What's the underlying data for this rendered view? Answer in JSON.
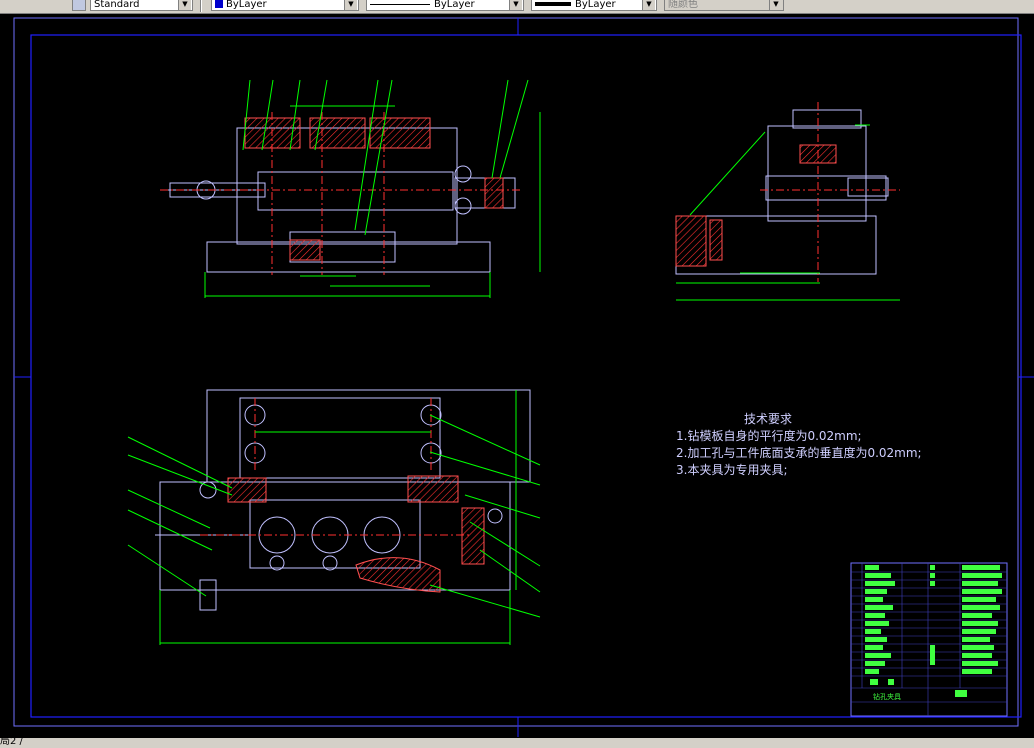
{
  "toolbar": {
    "text_style": "Standard",
    "color": "ByLayer",
    "linetype": "ByLayer",
    "lineweight": "ByLayer",
    "plot_style": "随颜色"
  },
  "tech_requirements": {
    "title": "技术要求",
    "items": [
      "1.钻模板自身的平行度为0.02mm;",
      "2.加工孔与工件底面支承的垂直度为0.02mm;",
      "3.本夹具为专用夹具;"
    ]
  },
  "status": {
    "layout_tab": "局2 /"
  },
  "title_block": {
    "drawing_name": "钻孔夹具"
  },
  "colors": {
    "background": "#000000",
    "border": "#0000ff",
    "outline": "#c8c8ff",
    "dimension": "#00ff00",
    "centerline": "#ff3030",
    "hatch": "#ff4040",
    "text": "#cfcfff"
  }
}
